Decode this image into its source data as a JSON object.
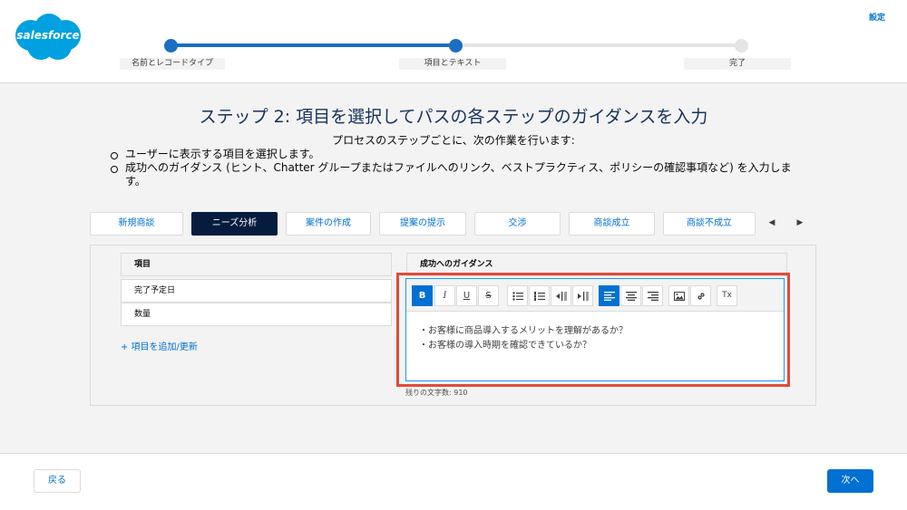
{
  "header": {
    "logo_text": "salesforce",
    "settings_label": "設定"
  },
  "wizard": {
    "steps": [
      {
        "label": "名前とレコードタイプ"
      },
      {
        "label": "項目とテキスト"
      },
      {
        "label": "完了"
      }
    ],
    "progress_fraction": 0.5
  },
  "content": {
    "title": "ステップ 2: 項目を選択してパスの各ステップのガイダンスを入力",
    "intro": "プロセスのステップごとに、次の作業を行います:",
    "bullets": [
      "ユーザーに表示する項目を選択します。",
      "成功へのガイダンス (ヒント、Chatter グループまたはファイルへのリンク、ベストプラクティス、ポリシーの確認事項など) を入力します。"
    ]
  },
  "path_tabs": [
    {
      "label": "新規商談"
    },
    {
      "label": "ニーズ分析"
    },
    {
      "label": "案件の作成"
    },
    {
      "label": "提案の提示"
    },
    {
      "label": "交渉"
    },
    {
      "label": "商談成立"
    },
    {
      "label": "商談不成立"
    }
  ],
  "fields": {
    "header": "項目",
    "rows": [
      "完了予定日",
      "数量"
    ],
    "add_link": "+ 項目を追加/更新"
  },
  "guidance": {
    "header": "成功へのガイダンス",
    "lines": [
      "・お客様に商品導入するメリットを理解があるか？",
      "・お客様の導入時期を確認できているか？"
    ],
    "char_count": "残りの文字数: 910"
  },
  "toolbar": {
    "bold": "B",
    "italic": "I",
    "underline": "U",
    "strike": "S",
    "clear": "Tx"
  },
  "footer": {
    "back_label": "戻る",
    "next_label": "次へ"
  },
  "colors": {
    "brand": "#0070d2",
    "path_active": "#061c3f",
    "highlight": "#e04a3a",
    "progress": "#1b6ec2"
  }
}
